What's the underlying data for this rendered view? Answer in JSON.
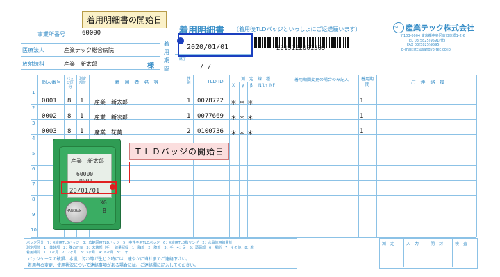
{
  "header": {
    "office_label": "事業所番号",
    "office_number": "60000",
    "medical_label": "医療法人",
    "medical_value": "産業テック総合病院",
    "dept_label": "放射線科",
    "dept_value": "産業　新太郎",
    "honorific": "様"
  },
  "doc_title": {
    "main": "着用明細書",
    "sub": "〔着用後TLDバッジといっしょにご返送願います〕"
  },
  "company": {
    "name": "産業テック株式会社",
    "logo_text": "STC",
    "address": "〒103-0004 東京都中央区東日本橋1-2-6",
    "tel": "TEL 03(5825)9591(代)",
    "fax": "FAX 03(5825)9595",
    "email": "E-mail:stc@sangyo-tec.co.jp"
  },
  "period": {
    "label_chars": [
      "着",
      "用",
      "期",
      "間"
    ],
    "start_label": "始",
    "start_date": "2020/01/01",
    "end_label": "終了",
    "end_date": "/ /",
    "doc_number": "2019122001305"
  },
  "table": {
    "headers": {
      "no": "個人番号",
      "badge_type": "バッジ区分",
      "measure_part": "測定部位",
      "wearer": "着　用　者　名　等",
      "gender": "性別",
      "tld_id": "TLD ID",
      "measure_line": "測　定　線　種",
      "line_x": "X",
      "line_y": "γ",
      "line_beta": "β",
      "line_n": "N/th",
      "line_nf": "NF",
      "change_note": "着用期間変更の場合のみ記入",
      "period_col": "着用期間",
      "contact": "ご　連　絡　欄"
    },
    "row_numbers": [
      "1",
      "2",
      "3",
      "4",
      "5",
      "6",
      "7",
      "8",
      "9",
      "10"
    ],
    "rows": [
      {
        "no": "0001",
        "badge": "8",
        "part": "1",
        "name": "産業　新太郎",
        "gender": "1",
        "tld": "0078722",
        "stars": "＊ ＊ ＊",
        "period": "1"
      },
      {
        "no": "0002",
        "badge": "8",
        "part": "1",
        "name": "産業　新次郎",
        "gender": "1",
        "tld": "0077669",
        "stars": "＊ ＊ ＊",
        "period": "1"
      },
      {
        "no": "0003",
        "badge": "8",
        "part": "1",
        "name": "産業　花美",
        "gender": "2",
        "tld": "0100736",
        "stars": "＊ ＊ ＊",
        "period": "1"
      }
    ]
  },
  "footer": {
    "legend_1": "バッジ区分　7：X線用TLDバッジ　3：広範囲用TLDバッジ　5：中性子用TLDバッジ　6：X線用TLD指リング　2：水晶体用線量計",
    "legend_2": "測定部位　1：体幹部　2：腹の正面　3：末端部（手）　線量記録　1：胸部　2：腹部　3：手　4：足　5：頭頸部　6：場所　7：その他　8：腕",
    "legend_3": "着用期間　1：1ヶ月　2：2ヶ月　3：3ヶ月　4：6ヶ月　5：1年",
    "note_1": "バッジケースの破損、水没、汚れ等が生じた時には、速やかに当社までご連絡下さい。",
    "note_2": "着用者の変更、使用状況について連絡事項がある場合には、ご連絡欄に記入してください。",
    "stamp_labels": [
      "測　定",
      "入　力",
      "開　封",
      "検　査"
    ]
  },
  "badge_photo": {
    "name": "産業　新太郎",
    "office": "60000",
    "serial": "0001",
    "start": "20/01/01",
    "code": "XG",
    "grade": "B",
    "maker": "HARSHAW"
  },
  "callouts": {
    "doc_start": "着用明細書の開始日",
    "tld_start": "ＴＬＤバッジの開始日"
  },
  "colors": {
    "form_blue": "#3a8fc8",
    "callout_yellow": "#fbf1c8",
    "callout_pink": "#fbdede",
    "highlight_blue": "#1b3fbf",
    "highlight_red": "#e02020",
    "badge_green": "#2f9c54"
  }
}
